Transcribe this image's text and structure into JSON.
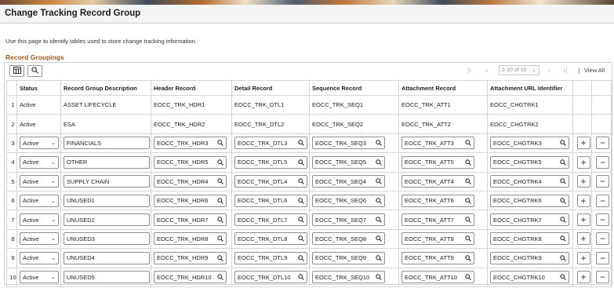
{
  "page": {
    "title": "Change Tracking Record Group",
    "instructions": "Use this page to identify tables used to store change tracking information.",
    "section_title": "Record Groupings"
  },
  "toolbar": {
    "personalize_icon": "grid-settings-icon",
    "search_icon": "search-icon",
    "pager_range": "1-10 of 10",
    "view_all": "View All"
  },
  "columns": {
    "status": "Status",
    "description": "Record Group Description",
    "header": "Header Record",
    "detail": "Detail Record",
    "sequence": "Sequence Record",
    "attachment": "Attachment Record",
    "url": "Attachment URL Identifier"
  },
  "rows": [
    {
      "num": "1",
      "status": "Active",
      "description": "ASSET LIFECYCLE",
      "header": "EOCC_TRK_HDR1",
      "detail": "EOCC_TRK_DTL1",
      "sequence": "EOCC_TRK_SEQ1",
      "attachment": "EOCC_TRK_ATT1",
      "url": "EOCC_CHGTRK1"
    },
    {
      "num": "2",
      "status": "Active",
      "description": "ESA",
      "header": "EOCC_TRK_HDR2",
      "detail": "EOCC_TRK_DTL2",
      "sequence": "EOCC_TRK_SEQ2",
      "attachment": "EOCC_TRK_ATT2",
      "url": "EOCC_CHGTRK2"
    },
    {
      "num": "3",
      "status": "Active",
      "description": "FINANCIALS",
      "header": "EOCC_TRK_HDR3",
      "detail": "EOCC_TRK_DTL3",
      "sequence": "EOCC_TRK_SEQ3",
      "attachment": "EOCC_TRK_ATT3",
      "url": "EOCC_CHGTRK3"
    },
    {
      "num": "4",
      "status": "Active",
      "description": "OTHER",
      "header": "EOCC_TRK_HDR5",
      "detail": "EOCC_TRK_DTL5",
      "sequence": "EOCC_TRK_SEQ5",
      "attachment": "EOCC_TRK_ATT5",
      "url": "EOCC_CHGTRK5"
    },
    {
      "num": "5",
      "status": "Active",
      "description": "SUPPLY CHAIN",
      "header": "EOCC_TRK_HDR4",
      "detail": "EOCC_TRK_DTL4",
      "sequence": "EOCC_TRK_SEQ4",
      "attachment": "EOCC_TRK_ATT4",
      "url": "EOCC_CHGTRK4"
    },
    {
      "num": "6",
      "status": "Active",
      "description": "UNUSED1",
      "header": "EOCC_TRK_HDR6",
      "detail": "EOCC_TRK_DTL6",
      "sequence": "EOCC_TRK_SEQ6",
      "attachment": "EOCC_TRK_ATT6",
      "url": "EOCC_CHGTRK6"
    },
    {
      "num": "7",
      "status": "Active",
      "description": "UNUSED2",
      "header": "EOCC_TRK_HDR7",
      "detail": "EOCC_TRK_DTL7",
      "sequence": "EOCC_TRK_SEQ7",
      "attachment": "EOCC_TRK_ATT7",
      "url": "EOCC_CHGTRK7"
    },
    {
      "num": "8",
      "status": "Active",
      "description": "UNUSED3",
      "header": "EOCC_TRK_HDR8",
      "detail": "EOCC_TRK_DTL8",
      "sequence": "EOCC_TRK_SEQ8",
      "attachment": "EOCC_TRK_ATT8",
      "url": "EOCC_CHGTRK8"
    },
    {
      "num": "9",
      "status": "Active",
      "description": "UNUSED4",
      "header": "EOCC_TRK_HDR9",
      "detail": "EOCC_TRK_DTL9",
      "sequence": "EOCC_TRK_SEQ9",
      "attachment": "EOCC_TRK_ATT9",
      "url": "EOCC_CHGTRK9"
    },
    {
      "num": "10",
      "status": "Active",
      "description": "UNUSED5",
      "header": "EOCC_TRK_HDR10",
      "detail": "EOCC_TRK_DTL10",
      "sequence": "EOCC_TRK_SEQ10",
      "attachment": "EOCC_TRK_ATT10",
      "url": "EOCC_CHGTRK10"
    }
  ],
  "row_buttons": {
    "add": "+",
    "delete": "−"
  },
  "colors": {
    "section_title": "#a35a1f",
    "border": "#d4d4d4",
    "header_bg": "#f4f4f4"
  }
}
